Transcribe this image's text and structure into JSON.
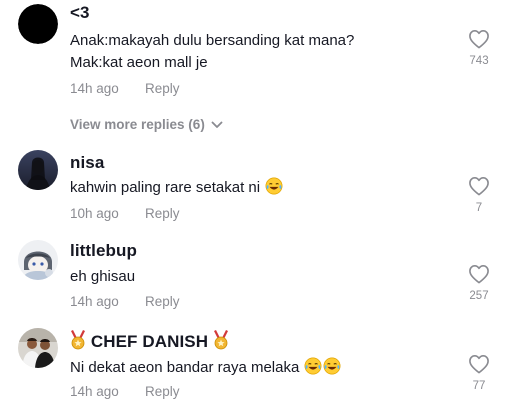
{
  "comments": [
    {
      "username": "<3",
      "lines": [
        "Anak:makayah dulu bersanding kat mana?",
        "Mak:kat aeon mall je"
      ],
      "time": "14h ago",
      "reply_label": "Reply",
      "likes": "743",
      "avatar": "black-circle"
    },
    {
      "username": "nisa",
      "lines": [
        "kahwin paling rare setakat ni"
      ],
      "emojis": [
        "laughing-tears-emoji"
      ],
      "time": "10h ago",
      "reply_label": "Reply",
      "likes": "7",
      "avatar": "dark-portrait"
    },
    {
      "username": "littlebup",
      "lines": [
        "eh ghisau"
      ],
      "time": "14h ago",
      "reply_label": "Reply",
      "likes": "257",
      "avatar": "anime-character"
    },
    {
      "username": "CHEF DANISH",
      "username_badges": [
        "medal-icon",
        "medal-icon"
      ],
      "lines": [
        "Ni dekat aeon bandar raya melaka"
      ],
      "emojis": [
        "laughing-tears-emoji",
        "laughing-tears-emoji"
      ],
      "time": "14h ago",
      "reply_label": "Reply",
      "likes": "77",
      "avatar": "two-people-photo"
    }
  ],
  "view_more_replies": "View more replies (6)",
  "colors": {
    "text_primary": "#161823",
    "text_secondary": "#8a8b91",
    "background": "#ffffff"
  }
}
